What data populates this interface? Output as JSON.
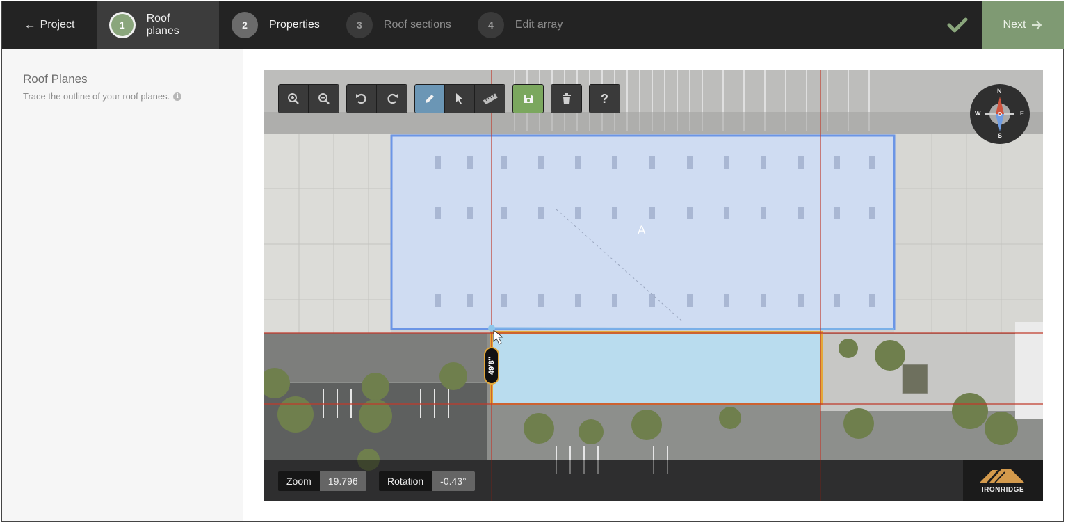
{
  "nav": {
    "back_label": "Project",
    "steps": [
      {
        "num": "1",
        "label": "Roof planes",
        "state": "active"
      },
      {
        "num": "2",
        "label": "Properties",
        "state": "done"
      },
      {
        "num": "3",
        "label": "Roof sections",
        "state": "future"
      },
      {
        "num": "4",
        "label": "Edit array",
        "state": "future"
      }
    ],
    "next_label": "Next"
  },
  "sidebar": {
    "title": "Roof Planes",
    "subtitle": "Trace the outline of your roof planes."
  },
  "toolbar": {
    "groups": [
      [
        "zoom-in",
        "zoom-out"
      ],
      [
        "undo",
        "redo"
      ],
      [
        "draw (active)",
        "select",
        "measure"
      ],
      [
        "save"
      ],
      [
        "delete"
      ],
      [
        "help"
      ]
    ],
    "help_glyph": "?"
  },
  "compass": {
    "n": "N",
    "s": "S",
    "e": "E",
    "w": "W"
  },
  "map": {
    "roof_plane_label": "A",
    "dimension_label": "49'8\"",
    "colors": {
      "plane_fill": "#cfdcf3",
      "plane_stroke": "#6b95e6",
      "active_fill": "#b9dcee",
      "active_stroke": "#e3a83a",
      "guide_line": "#c0392b"
    }
  },
  "readout": {
    "zoom_label": "Zoom",
    "zoom_value": "19.796",
    "rotation_label": "Rotation",
    "rotation_value": "-0.43°"
  },
  "logo": {
    "text": "IRONRIDGE"
  },
  "theme": {
    "topbar": "#232323",
    "accent_green": "#7f9a73",
    "active_step": "#8aa67c",
    "draw_tool": "#6b96b5",
    "save_tool": "#7ba75e"
  }
}
